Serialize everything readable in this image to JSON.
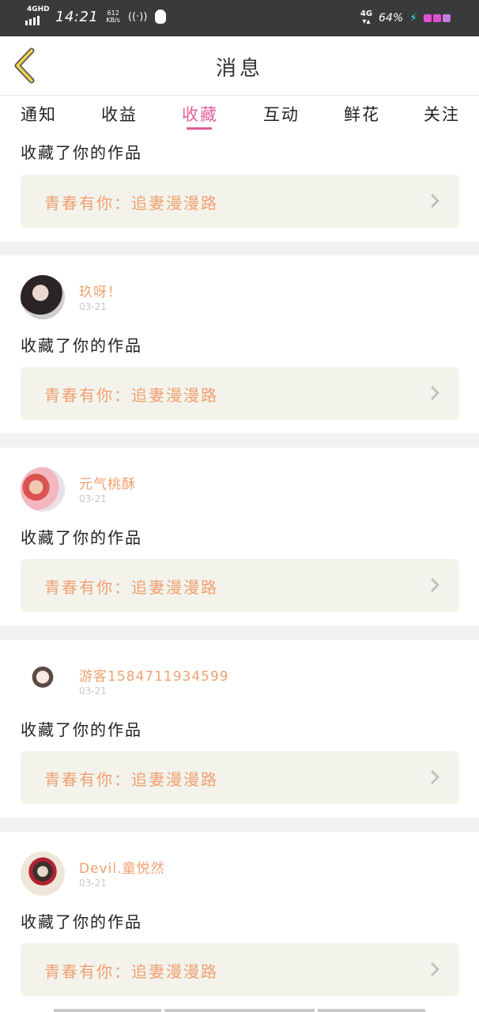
{
  "status_bar": {
    "network_tag": "4GHD",
    "time": "14:21",
    "speed_value": "612",
    "speed_unit": "KB/s",
    "signal_right": "4G",
    "battery": "64%"
  },
  "header": {
    "title": "消息"
  },
  "tabs": [
    {
      "label": "通知",
      "active": false
    },
    {
      "label": "收益",
      "active": false
    },
    {
      "label": "收藏",
      "active": true
    },
    {
      "label": "互动",
      "active": false
    },
    {
      "label": "鲜花",
      "active": false
    },
    {
      "label": "关注",
      "active": false
    }
  ],
  "items": [
    {
      "user": "",
      "date": "",
      "action": "收藏了你的作品",
      "work": "青春有你：追妻漫漫路"
    },
    {
      "user": "玖呀！",
      "date": "03-21",
      "action": "收藏了你的作品",
      "work": "青春有你：追妻漫漫路"
    },
    {
      "user": "元气桃酥",
      "date": "03-21",
      "action": "收藏了你的作品",
      "work": "青春有你：追妻漫漫路"
    },
    {
      "user": "游客15847119345​99",
      "date": "03-21",
      "action": "收藏了你的作品",
      "work": "青春有你：追妻漫漫路"
    },
    {
      "user": "Devil.童悦然",
      "date": "03-21",
      "action": "收藏了你的作品",
      "work": "青春有你：追妻漫漫路"
    }
  ],
  "colors": {
    "accent": "#e0609a",
    "username": "#f0a070",
    "card_bg": "#f3f3ec",
    "separator": "#f2f2f2"
  }
}
